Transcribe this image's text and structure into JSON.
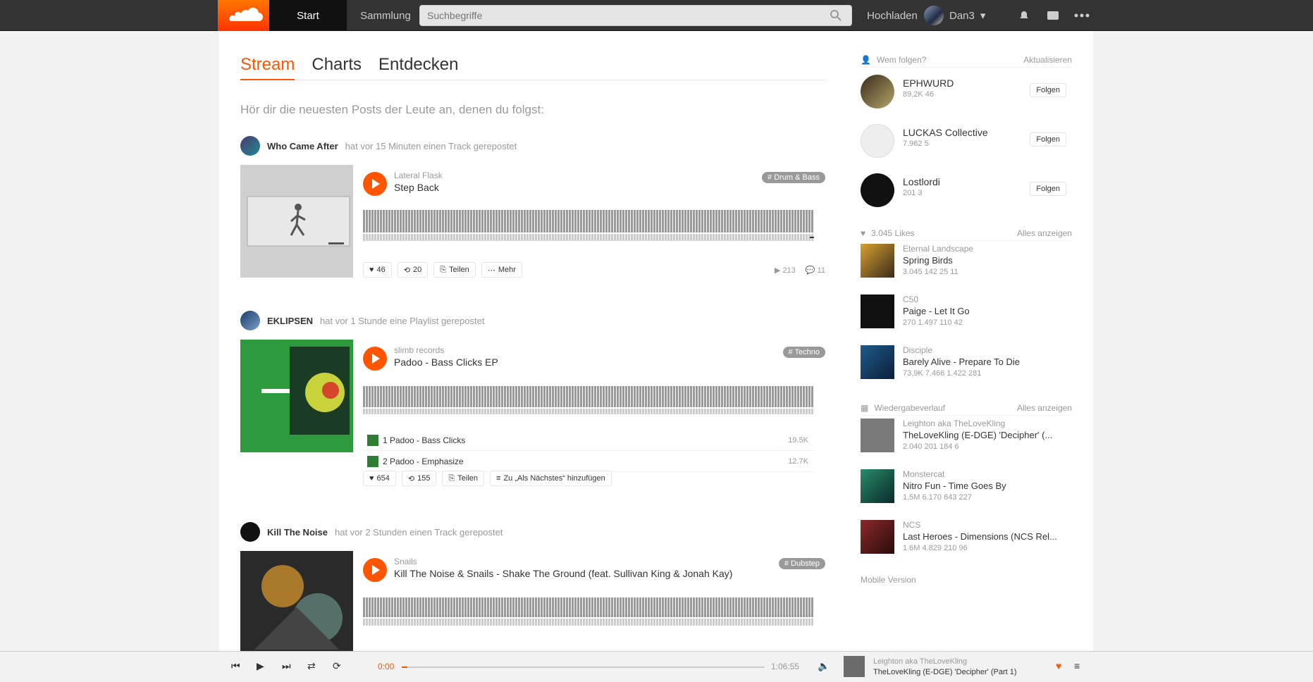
{
  "header": {
    "nav_home": "Start",
    "nav_collection": "Sammlung",
    "search_placeholder": "Suchbegriffe",
    "upload": "Hochladen",
    "username": "Dan3"
  },
  "tabs": [
    {
      "label": "Stream"
    },
    {
      "label": "Charts"
    },
    {
      "label": "Entdecken"
    }
  ],
  "intro": "Hör dir die neuesten Posts der Leute an, denen du folgst:",
  "posts": [
    {
      "who": "Who Came After",
      "meta": "hat vor 15 Minuten einen Track gerepostet",
      "track_user": "Lateral Flask",
      "title": "Step Back",
      "tag": "# Drum & Bass",
      "actions": [
        "46",
        "20",
        "Teilen",
        "Mehr"
      ],
      "stats": [
        "213",
        "11"
      ]
    },
    {
      "who": "EKLIPSEN",
      "meta": "hat vor 1 Stunde eine Playlist gerepostet",
      "track_user": "slimb records",
      "title": "Padoo - Bass Clicks EP",
      "tag": "# Techno",
      "rows": [
        {
          "label": "1 Padoo - Bass Clicks",
          "plays": "19.5K"
        },
        {
          "label": "2 Padoo - Emphasize",
          "plays": "12.7K"
        }
      ],
      "actions": [
        "654",
        "155",
        "Teilen",
        "Zu „Als Nächstes“ hinzufügen"
      ]
    },
    {
      "who": "Kill The Noise",
      "meta": "hat vor 2 Stunden einen Track gerepostet",
      "track_user": "Snails",
      "title": "Kill The Noise & Snails - Shake The Ground (feat. Sullivan King & Jonah Kay)",
      "tag": "# Dubstep"
    }
  ],
  "sidebar": {
    "follow_title": "Wem folgen?",
    "refresh": "Aktualisieren",
    "follow": [
      {
        "name": "EPHWURD",
        "stats": "89,2K   46",
        "btn": "Folgen"
      },
      {
        "name": "LUCKAS Collective",
        "stats": "7.962   5",
        "btn": "Folgen"
      },
      {
        "name": "Lostlordi",
        "stats": "201   3",
        "btn": "Folgen"
      }
    ],
    "likes_title": "3.045 Likes",
    "likes_all": "Alles anzeigen",
    "likes": [
      {
        "user": "Eternal Landscape",
        "title": "Spring Birds",
        "stats": "3.045  142  25  11"
      },
      {
        "user": "C50",
        "title": "Paige - Let It Go",
        "stats": "270  1.497  110  42"
      },
      {
        "user": "Disciple",
        "title": "Barely Alive - Prepare To Die",
        "stats": "73,9K  7.466  1.422  281"
      }
    ],
    "history_title": "Wiedergabeverlauf",
    "history_all": "Alles anzeigen",
    "history": [
      {
        "user": "Leighton aka TheLoveKling",
        "title": "TheLoveKling (E-DGE) 'Decipher' (...",
        "stats": "2.040  201  184  6"
      },
      {
        "user": "Monstercat",
        "title": "Nitro Fun - Time Goes By",
        "stats": "1,5M  6.170  643  227"
      },
      {
        "user": "NCS",
        "title": "Last Heroes - Dimensions (NCS Rel...",
        "stats": "1.6M  4.829  210  96"
      }
    ],
    "mobile": "Mobile Version"
  },
  "player": {
    "time_current": "0:00",
    "time_total": "1:06:55",
    "now_user": "Leighton aka TheLoveKling",
    "now_title": "TheLoveKling (E-DGE) 'Decipher' (Part 1)"
  },
  "colors": {
    "accent": "#ff5500",
    "header": "#333333"
  }
}
